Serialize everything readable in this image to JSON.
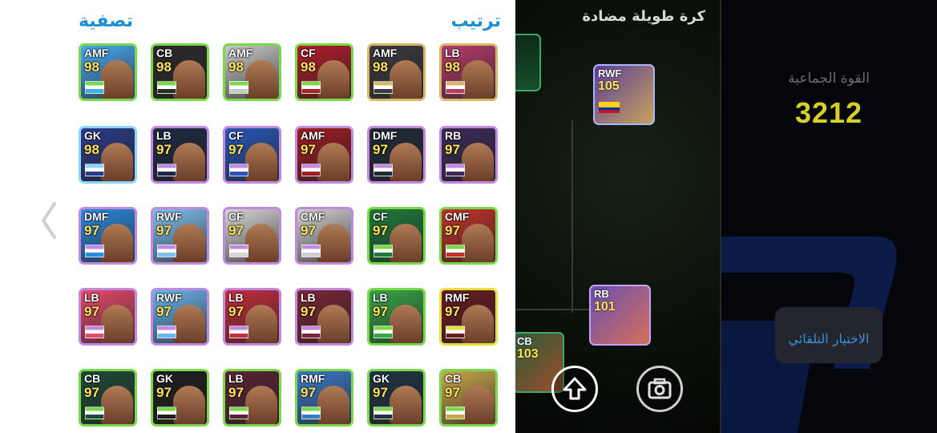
{
  "panel": {
    "sort_label": "ترتيب",
    "filter_label": "تصفية",
    "cards": [
      {
        "pos": "AMF",
        "rating": "98",
        "color": "#4aa8f0",
        "border": "#7ad84a"
      },
      {
        "pos": "CB",
        "rating": "98",
        "color": "#2a2a2a",
        "border": "#7ad84a"
      },
      {
        "pos": "AMF",
        "rating": "98",
        "color": "#c8c8c8",
        "border": "#7ad84a"
      },
      {
        "pos": "CF",
        "rating": "98",
        "color": "#b01d2a",
        "border": "#7ad84a"
      },
      {
        "pos": "AMF",
        "rating": "98",
        "color": "#3b3a40",
        "border": "#d7b86a"
      },
      {
        "pos": "LB",
        "rating": "98",
        "color": "#b83a6b",
        "border": "#d7b86a"
      },
      {
        "pos": "GK",
        "rating": "98",
        "color": "#2a3b8a",
        "border": "#8fd3ff"
      },
      {
        "pos": "LB",
        "rating": "97",
        "color": "#1b2a44",
        "border": "#c28adf"
      },
      {
        "pos": "CF",
        "rating": "97",
        "color": "#2857b8",
        "border": "#c28adf"
      },
      {
        "pos": "AMF",
        "rating": "97",
        "color": "#9e1c22",
        "border": "#c28adf"
      },
      {
        "pos": "DMF",
        "rating": "97",
        "color": "#1f2a36",
        "border": "#c28adf"
      },
      {
        "pos": "RB",
        "rating": "97",
        "color": "#3b2a58",
        "border": "#c28adf"
      },
      {
        "pos": "DMF",
        "rating": "97",
        "color": "#2b8ae0",
        "border": "#c28adf"
      },
      {
        "pos": "RWF",
        "rating": "97",
        "color": "#7fc0ef",
        "border": "#c28adf"
      },
      {
        "pos": "CF",
        "rating": "97",
        "color": "#d5d5d5",
        "border": "#c28adf"
      },
      {
        "pos": "CMF",
        "rating": "97",
        "color": "#cfcfcf",
        "border": "#c28adf"
      },
      {
        "pos": "CF",
        "rating": "97",
        "color": "#1f7a3a",
        "border": "#7ad84a"
      },
      {
        "pos": "CMF",
        "rating": "97",
        "color": "#c4322a",
        "border": "#7ad84a"
      },
      {
        "pos": "LB",
        "rating": "97",
        "color": "#e64a6b",
        "border": "#c28adf"
      },
      {
        "pos": "RWF",
        "rating": "97",
        "color": "#6ab4ec",
        "border": "#c28adf"
      },
      {
        "pos": "LB",
        "rating": "97",
        "color": "#c42d3d",
        "border": "#c28adf"
      },
      {
        "pos": "LB",
        "rating": "97",
        "color": "#7a2635",
        "border": "#c28adf"
      },
      {
        "pos": "LB",
        "rating": "97",
        "color": "#36a548",
        "border": "#7ad84a"
      },
      {
        "pos": "RMF",
        "rating": "97",
        "color": "#6a1a20",
        "border": "#e6e040"
      },
      {
        "pos": "CB",
        "rating": "97",
        "color": "#1d4a34",
        "border": "#7ad84a"
      },
      {
        "pos": "GK",
        "rating": "97",
        "color": "#1c1c1c",
        "border": "#7ad84a"
      },
      {
        "pos": "LB",
        "rating": "97",
        "color": "#5a2333",
        "border": "#7ad84a"
      },
      {
        "pos": "RMF",
        "rating": "97",
        "color": "#3a7ac8",
        "border": "#7ad84a"
      },
      {
        "pos": "GK",
        "rating": "97",
        "color": "#203444",
        "border": "#7ad84a"
      },
      {
        "pos": "CB",
        "rating": "97",
        "color": "#c8a74a",
        "border": "#7ad84a"
      }
    ]
  },
  "field": {
    "style_title": "كرة طويلة مضادة",
    "cards": {
      "rwf": {
        "pos": "RWF",
        "rating": "105"
      },
      "rb": {
        "pos": "RB",
        "rating": "101"
      },
      "cb_partial": {
        "pos": "CB",
        "rating": "103"
      }
    }
  },
  "info": {
    "team_strength_label": "القوة الجماعية",
    "team_strength_value": "3212",
    "auto_select_label": "الاختيار التلقائي"
  },
  "colors": {
    "accent": "#1a8fd4",
    "strength": "#d8cf2a"
  }
}
